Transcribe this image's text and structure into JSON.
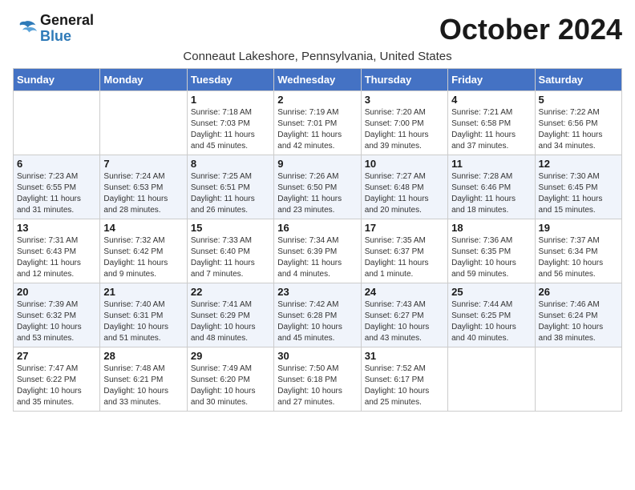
{
  "header": {
    "logo_line1": "General",
    "logo_line2": "Blue",
    "month": "October 2024",
    "location": "Conneaut Lakeshore, Pennsylvania, United States"
  },
  "days_of_week": [
    "Sunday",
    "Monday",
    "Tuesday",
    "Wednesday",
    "Thursday",
    "Friday",
    "Saturday"
  ],
  "weeks": [
    [
      {
        "day": "",
        "info": ""
      },
      {
        "day": "",
        "info": ""
      },
      {
        "day": "1",
        "info": "Sunrise: 7:18 AM\nSunset: 7:03 PM\nDaylight: 11 hours\nand 45 minutes."
      },
      {
        "day": "2",
        "info": "Sunrise: 7:19 AM\nSunset: 7:01 PM\nDaylight: 11 hours\nand 42 minutes."
      },
      {
        "day": "3",
        "info": "Sunrise: 7:20 AM\nSunset: 7:00 PM\nDaylight: 11 hours\nand 39 minutes."
      },
      {
        "day": "4",
        "info": "Sunrise: 7:21 AM\nSunset: 6:58 PM\nDaylight: 11 hours\nand 37 minutes."
      },
      {
        "day": "5",
        "info": "Sunrise: 7:22 AM\nSunset: 6:56 PM\nDaylight: 11 hours\nand 34 minutes."
      }
    ],
    [
      {
        "day": "6",
        "info": "Sunrise: 7:23 AM\nSunset: 6:55 PM\nDaylight: 11 hours\nand 31 minutes."
      },
      {
        "day": "7",
        "info": "Sunrise: 7:24 AM\nSunset: 6:53 PM\nDaylight: 11 hours\nand 28 minutes."
      },
      {
        "day": "8",
        "info": "Sunrise: 7:25 AM\nSunset: 6:51 PM\nDaylight: 11 hours\nand 26 minutes."
      },
      {
        "day": "9",
        "info": "Sunrise: 7:26 AM\nSunset: 6:50 PM\nDaylight: 11 hours\nand 23 minutes."
      },
      {
        "day": "10",
        "info": "Sunrise: 7:27 AM\nSunset: 6:48 PM\nDaylight: 11 hours\nand 20 minutes."
      },
      {
        "day": "11",
        "info": "Sunrise: 7:28 AM\nSunset: 6:46 PM\nDaylight: 11 hours\nand 18 minutes."
      },
      {
        "day": "12",
        "info": "Sunrise: 7:30 AM\nSunset: 6:45 PM\nDaylight: 11 hours\nand 15 minutes."
      }
    ],
    [
      {
        "day": "13",
        "info": "Sunrise: 7:31 AM\nSunset: 6:43 PM\nDaylight: 11 hours\nand 12 minutes."
      },
      {
        "day": "14",
        "info": "Sunrise: 7:32 AM\nSunset: 6:42 PM\nDaylight: 11 hours\nand 9 minutes."
      },
      {
        "day": "15",
        "info": "Sunrise: 7:33 AM\nSunset: 6:40 PM\nDaylight: 11 hours\nand 7 minutes."
      },
      {
        "day": "16",
        "info": "Sunrise: 7:34 AM\nSunset: 6:39 PM\nDaylight: 11 hours\nand 4 minutes."
      },
      {
        "day": "17",
        "info": "Sunrise: 7:35 AM\nSunset: 6:37 PM\nDaylight: 11 hours\nand 1 minute."
      },
      {
        "day": "18",
        "info": "Sunrise: 7:36 AM\nSunset: 6:35 PM\nDaylight: 10 hours\nand 59 minutes."
      },
      {
        "day": "19",
        "info": "Sunrise: 7:37 AM\nSunset: 6:34 PM\nDaylight: 10 hours\nand 56 minutes."
      }
    ],
    [
      {
        "day": "20",
        "info": "Sunrise: 7:39 AM\nSunset: 6:32 PM\nDaylight: 10 hours\nand 53 minutes."
      },
      {
        "day": "21",
        "info": "Sunrise: 7:40 AM\nSunset: 6:31 PM\nDaylight: 10 hours\nand 51 minutes."
      },
      {
        "day": "22",
        "info": "Sunrise: 7:41 AM\nSunset: 6:29 PM\nDaylight: 10 hours\nand 48 minutes."
      },
      {
        "day": "23",
        "info": "Sunrise: 7:42 AM\nSunset: 6:28 PM\nDaylight: 10 hours\nand 45 minutes."
      },
      {
        "day": "24",
        "info": "Sunrise: 7:43 AM\nSunset: 6:27 PM\nDaylight: 10 hours\nand 43 minutes."
      },
      {
        "day": "25",
        "info": "Sunrise: 7:44 AM\nSunset: 6:25 PM\nDaylight: 10 hours\nand 40 minutes."
      },
      {
        "day": "26",
        "info": "Sunrise: 7:46 AM\nSunset: 6:24 PM\nDaylight: 10 hours\nand 38 minutes."
      }
    ],
    [
      {
        "day": "27",
        "info": "Sunrise: 7:47 AM\nSunset: 6:22 PM\nDaylight: 10 hours\nand 35 minutes."
      },
      {
        "day": "28",
        "info": "Sunrise: 7:48 AM\nSunset: 6:21 PM\nDaylight: 10 hours\nand 33 minutes."
      },
      {
        "day": "29",
        "info": "Sunrise: 7:49 AM\nSunset: 6:20 PM\nDaylight: 10 hours\nand 30 minutes."
      },
      {
        "day": "30",
        "info": "Sunrise: 7:50 AM\nSunset: 6:18 PM\nDaylight: 10 hours\nand 27 minutes."
      },
      {
        "day": "31",
        "info": "Sunrise: 7:52 AM\nSunset: 6:17 PM\nDaylight: 10 hours\nand 25 minutes."
      },
      {
        "day": "",
        "info": ""
      },
      {
        "day": "",
        "info": ""
      }
    ]
  ]
}
